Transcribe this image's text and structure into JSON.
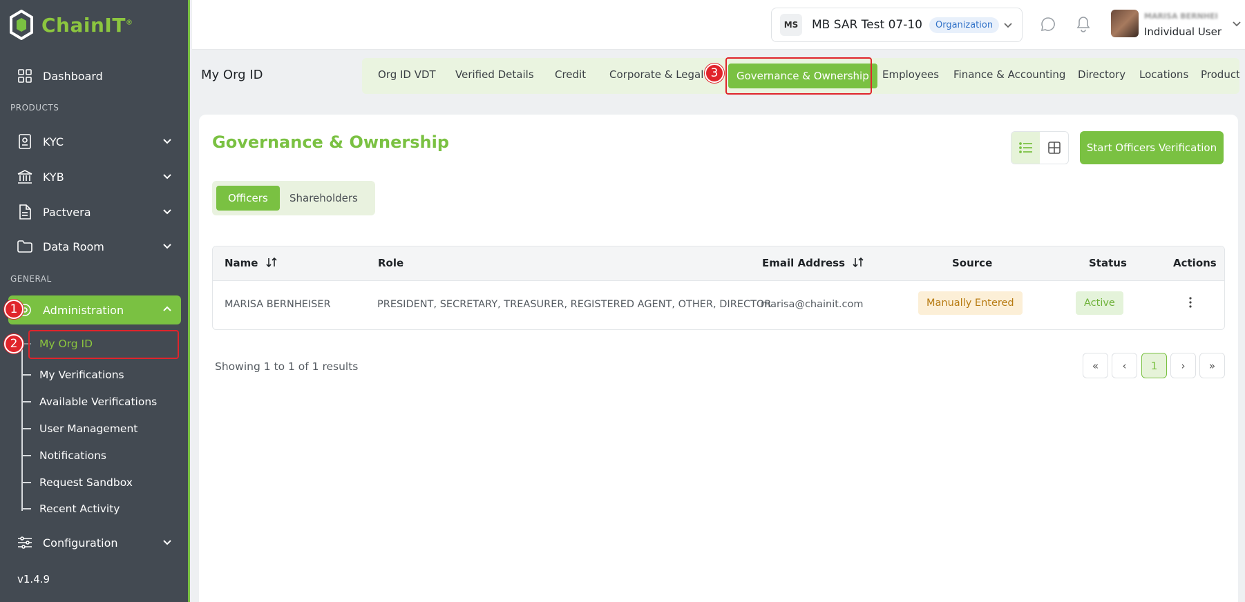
{
  "brand": {
    "name": "ChainIT",
    "mark": "®"
  },
  "sidebar": {
    "dashboard": "Dashboard",
    "products_label": "PRODUCTS",
    "kyc": "KYC",
    "kyb": "KYB",
    "pactvera": "Pactvera",
    "data_room": "Data Room",
    "general_label": "GENERAL",
    "administration": "Administration",
    "sub_items": [
      "My Org ID",
      "My Verifications",
      "Available Verifications",
      "User Management",
      "Notifications",
      "Request Sandbox",
      "Recent Activity"
    ],
    "configuration": "Configuration",
    "version": "v1.4.9"
  },
  "header": {
    "org_initials": "MS",
    "org_name": "MB SAR Test 07-10",
    "org_badge": "Organization",
    "user_name": "MARISA BERNHEI",
    "user_role": "Individual User"
  },
  "page": {
    "title": "My Org ID",
    "tabs": [
      "Org ID VDT",
      "Verified Details",
      "Credit",
      "Corporate & Legal",
      "Governance & Ownership",
      "Employees",
      "Finance & Accounting",
      "Directory",
      "Locations",
      "Product"
    ]
  },
  "steps": [
    "1",
    "2",
    "3"
  ],
  "card": {
    "title": "Governance & Ownership",
    "start_button": "Start Officers Verification",
    "segments": [
      "Officers",
      "Shareholders"
    ],
    "columns": [
      "Name",
      "Role",
      "Email Address",
      "Source",
      "Status",
      "Actions"
    ],
    "rows": [
      {
        "name": "MARISA BERNHEISER",
        "role": "PRESIDENT, SECRETARY, TREASURER, REGISTERED AGENT, OTHER, DIRECTOR",
        "email": "marisa@chainit.com",
        "source": "Manually Entered",
        "status": "Active"
      }
    ],
    "showing": "Showing 1 to 1 of 1 results",
    "pagination": {
      "first": "«",
      "prev": "‹",
      "current": "1",
      "next": "›",
      "last": "»"
    }
  },
  "colors": {
    "accent": "#7ac142",
    "sidebar": "#434a52",
    "highlight": "#e0242b"
  }
}
